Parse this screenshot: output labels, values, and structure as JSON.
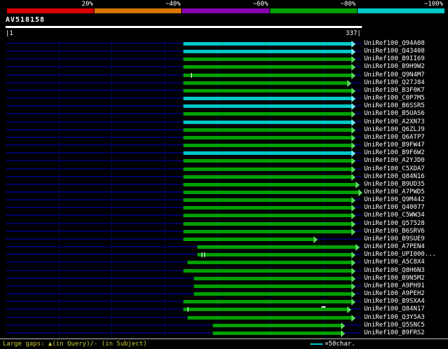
{
  "query": {
    "name": "AV518158",
    "start_label": "|1",
    "end_label": "337|"
  },
  "scale": {
    "segments": [
      {
        "label": "20%",
        "color": "#d80000"
      },
      {
        "label": "~40%",
        "color": "#d87400"
      },
      {
        "label": "~60%",
        "color": "#8800b0"
      },
      {
        "label": "~80%",
        "color": "#00a000"
      },
      {
        "label": "~100%",
        "color": "#00c8c8"
      }
    ]
  },
  "palette": {
    "green": {
      "bar": "#00a000",
      "arrow": "#58d858"
    },
    "cyan": {
      "bar": "#00c8c8",
      "arrow": "#70e8e8"
    }
  },
  "legend": {
    "gaps_label": "Large gaps: ▲(in Query)/- (in Subject)",
    "scale_label": "=50char."
  },
  "chart_data": {
    "type": "bar",
    "orientation": "horizontal",
    "title": "AV518158 similarity search graphical overview",
    "x_axis": {
      "min": 1,
      "max": 337,
      "tick_labels": [
        "1",
        "337"
      ]
    },
    "identity_scale": {
      "labels": [
        "20%",
        "~40%",
        "~60%",
        "~80%",
        "~100%"
      ],
      "colors": [
        "#d80000",
        "#d87400",
        "#8800b0",
        "#00a000",
        "#00c8c8"
      ]
    },
    "grid_interval_chars": 50,
    "hits": [
      {
        "label": "UniRef100_Q94A08",
        "color": "cyan",
        "qstart": 169,
        "qend": 328,
        "gaps": []
      },
      {
        "label": "UniRef100_Q43408",
        "color": "cyan",
        "qstart": 169,
        "qend": 328,
        "gaps": []
      },
      {
        "label": "UniRef100_B9II69",
        "color": "green",
        "qstart": 169,
        "qend": 328,
        "gaps": []
      },
      {
        "label": "UniRef100_B9H9W2",
        "color": "green",
        "qstart": 169,
        "qend": 328,
        "gaps": []
      },
      {
        "label": "UniRef100_Q9N4M7",
        "color": "green",
        "qstart": 169,
        "qend": 328,
        "gaps": [
          {
            "pos": 176,
            "type": "tick"
          }
        ]
      },
      {
        "label": "UniRef100_Q27J84",
        "color": "green",
        "qstart": 169,
        "qend": 324,
        "gaps": []
      },
      {
        "label": "UniRef100_B3F0K7",
        "color": "green",
        "qstart": 169,
        "qend": 328,
        "gaps": []
      },
      {
        "label": "UniRef100_C0P7M5",
        "color": "cyan",
        "qstart": 169,
        "qend": 328,
        "gaps": []
      },
      {
        "label": "UniRef100_B6SSR5",
        "color": "cyan",
        "qstart": 169,
        "qend": 328,
        "gaps": []
      },
      {
        "label": "UniRef100_B5UAS6",
        "color": "green",
        "qstart": 169,
        "qend": 328,
        "gaps": []
      },
      {
        "label": "UniRef100_A2XN73",
        "color": "cyan",
        "qstart": 169,
        "qend": 328,
        "gaps": []
      },
      {
        "label": "UniRef100_Q6ZLJ9",
        "color": "green",
        "qstart": 169,
        "qend": 328,
        "gaps": []
      },
      {
        "label": "UniRef100_Q6ATP7",
        "color": "green",
        "qstart": 169,
        "qend": 328,
        "gaps": []
      },
      {
        "label": "UniRef100_B9FW47",
        "color": "green",
        "qstart": 169,
        "qend": 328,
        "gaps": []
      },
      {
        "label": "UniRef100_B9F6W2",
        "color": "cyan",
        "qstart": 169,
        "qend": 328,
        "gaps": []
      },
      {
        "label": "UniRef100_A2YJD0",
        "color": "green",
        "qstart": 169,
        "qend": 328,
        "gaps": []
      },
      {
        "label": "UniRef100_C5XDA7",
        "color": "green",
        "qstart": 169,
        "qend": 328,
        "gaps": []
      },
      {
        "label": "UniRef100_Q84N16",
        "color": "green",
        "qstart": 169,
        "qend": 328,
        "gaps": []
      },
      {
        "label": "UniRef100_B9UD35",
        "color": "green",
        "qstart": 169,
        "qend": 332,
        "gaps": []
      },
      {
        "label": "UniRef100_A7PWD5",
        "color": "green",
        "qstart": 169,
        "qend": 334,
        "gaps": []
      },
      {
        "label": "UniRef100_Q9M442",
        "color": "green",
        "qstart": 169,
        "qend": 328,
        "gaps": []
      },
      {
        "label": "UniRef100_Q40077",
        "color": "green",
        "qstart": 169,
        "qend": 328,
        "gaps": []
      },
      {
        "label": "UniRef100_C5WW34",
        "color": "green",
        "qstart": 169,
        "qend": 328,
        "gaps": []
      },
      {
        "label": "UniRef100_Q57528",
        "color": "green",
        "qstart": 169,
        "qend": 328,
        "gaps": []
      },
      {
        "label": "UniRef100_B6SRV6",
        "color": "green",
        "qstart": 169,
        "qend": 328,
        "gaps": []
      },
      {
        "label": "UniRef100_B9SUE9",
        "color": "green",
        "qstart": 169,
        "qend": 292,
        "gaps": []
      },
      {
        "label": "UniRef100_A7PEN4",
        "color": "green",
        "qstart": 182,
        "qend": 332,
        "gaps": []
      },
      {
        "label": "UniRef100_UPI000...",
        "color": "green",
        "qstart": 182,
        "qend": 328,
        "gaps": [
          {
            "pos": 186,
            "type": "tick"
          },
          {
            "pos": 189,
            "type": "tick"
          }
        ]
      },
      {
        "label": "UniRef100_A5C8X4",
        "color": "green",
        "qstart": 173,
        "qend": 328,
        "gaps": []
      },
      {
        "label": "UniRef100_Q8H6N3",
        "color": "green",
        "qstart": 169,
        "qend": 328,
        "gaps": []
      },
      {
        "label": "UniRef100_B9N5M2",
        "color": "green",
        "qstart": 179,
        "qend": 328,
        "gaps": []
      },
      {
        "label": "UniRef100_A9PH91",
        "color": "green",
        "qstart": 179,
        "qend": 328,
        "gaps": []
      },
      {
        "label": "UniRef100_A9PEH2",
        "color": "green",
        "qstart": 179,
        "qend": 328,
        "gaps": []
      },
      {
        "label": "UniRef100_B9SXA4",
        "color": "green",
        "qstart": 169,
        "qend": 328,
        "gaps": []
      },
      {
        "label": "UniRef100_Q84N17",
        "color": "green",
        "qstart": 169,
        "qend": 324,
        "gaps": [
          {
            "pos": 173,
            "type": "tick"
          },
          {
            "pos": 301,
            "type": "dash"
          }
        ]
      },
      {
        "label": "UniRef100_Q3Y5A3",
        "color": "green",
        "qstart": 173,
        "qend": 328,
        "gaps": []
      },
      {
        "label": "UniRef100_Q5SNC5",
        "color": "green",
        "qstart": 197,
        "qend": 318,
        "gaps": []
      },
      {
        "label": "UniRef100_B9FRS2",
        "color": "green",
        "qstart": 197,
        "qend": 318,
        "gaps": []
      }
    ]
  }
}
